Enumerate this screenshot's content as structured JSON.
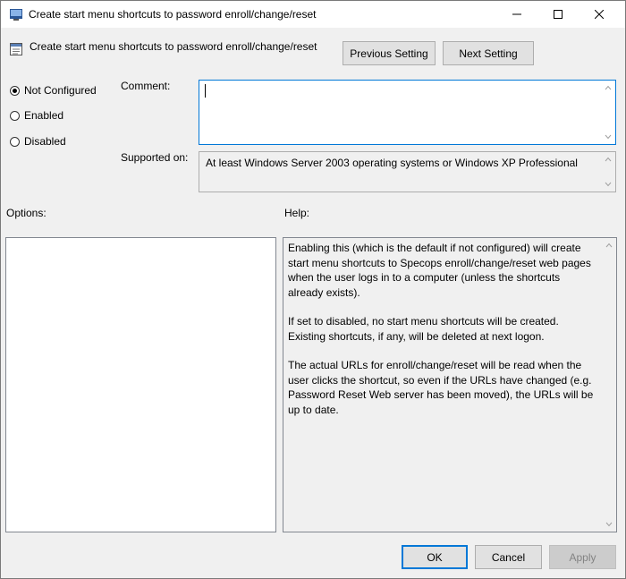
{
  "window": {
    "title": "Create start menu shortcuts to password enroll/change/reset"
  },
  "header": {
    "setting_name": "Create start menu shortcuts to password enroll/change/reset",
    "previous_label": "Previous Setting",
    "next_label": "Next Setting"
  },
  "state": {
    "options": [
      {
        "label": "Not Configured",
        "selected": true
      },
      {
        "label": "Enabled",
        "selected": false
      },
      {
        "label": "Disabled",
        "selected": false
      }
    ]
  },
  "comment": {
    "label": "Comment:",
    "value": ""
  },
  "supported": {
    "label": "Supported on:",
    "value": "At least Windows Server 2003 operating systems or Windows XP Professional"
  },
  "options_panel": {
    "label": "Options:"
  },
  "help_panel": {
    "label": "Help:",
    "paragraphs": [
      "Enabling this (which is the default if not configured) will create start menu shortcuts to Specops enroll/change/reset web pages when the user logs in to a computer (unless the shortcuts already exists).",
      "If set to disabled, no start menu shortcuts will be created. Existing shortcuts, if any, will be deleted at next logon.",
      "The actual URLs for enroll/change/reset will be read when the user clicks the shortcut, so even if the URLs have changed (e.g. Password Reset Web server has been moved), the URLs will be up to date."
    ]
  },
  "footer": {
    "ok_label": "OK",
    "cancel_label": "Cancel",
    "apply_label": "Apply"
  },
  "icons": {
    "title": "policy-setting-icon",
    "header": "policy-document-icon",
    "minimize": "minimize-icon",
    "maximize": "maximize-icon",
    "close": "close-icon"
  },
  "colors": {
    "accent": "#0078d7",
    "button_face": "#e1e1e1",
    "window_bg": "#f0f0f0"
  }
}
